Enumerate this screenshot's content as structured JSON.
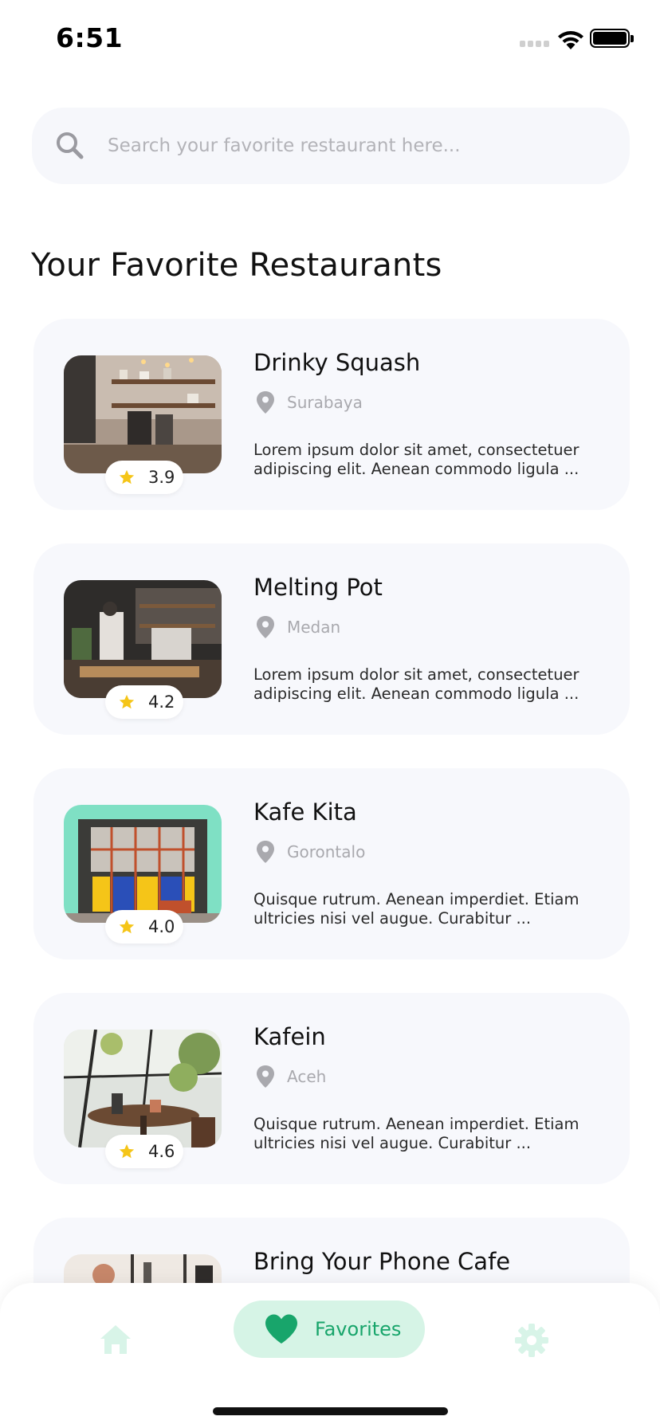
{
  "status_bar": {
    "time": "6:51",
    "icons": [
      "signal-dots-icon",
      "wifi-icon",
      "battery-icon"
    ]
  },
  "search": {
    "icon": "search-icon",
    "placeholder": "Search your favorite restaurant here...",
    "value": ""
  },
  "page": {
    "title": "Your Favorite Restaurants"
  },
  "restaurants": [
    {
      "name": "Drinky Squash",
      "city": "Surabaya",
      "rating": "3.9",
      "description": "Lorem ipsum dolor sit amet, consectetuer adipiscing elit. Aenean commodo ligula ...",
      "image": "cafe-counter-photo"
    },
    {
      "name": "Melting Pot",
      "city": "Medan",
      "rating": "4.2",
      "description": "Lorem ipsum dolor sit amet, consectetuer adipiscing elit. Aenean commodo ligula ...",
      "image": "kitchen-photo"
    },
    {
      "name": "Kafe Kita",
      "city": "Gorontalo",
      "rating": "4.0",
      "description": "Quisque rutrum. Aenean imperdiet. Etiam ultricies nisi vel augue. Curabitur ...",
      "image": "storefront-photo"
    },
    {
      "name": "Kafein",
      "city": "Aceh",
      "rating": "4.6",
      "description": "Quisque rutrum. Aenean imperdiet. Etiam ultricies nisi vel augue. Curabitur ...",
      "image": "garden-table-photo"
    },
    {
      "name": "Bring Your Phone Cafe",
      "city": "",
      "rating": "",
      "description": "",
      "image": "bar-interior-photo"
    }
  ],
  "bottom_nav": {
    "items": [
      {
        "id": "home",
        "label": "",
        "icon": "home-icon",
        "active": false
      },
      {
        "id": "favorites",
        "label": "Favorites",
        "icon": "heart-icon",
        "active": true
      },
      {
        "id": "settings",
        "label": "",
        "icon": "gear-icon",
        "active": false
      }
    ]
  },
  "colors": {
    "accent": "#18a56b",
    "accent_soft": "#d6f4e6",
    "inactive_icon": "#d8f4e8",
    "card_bg": "#f7f8fc",
    "star": "#f5c518",
    "muted_text": "#a9a9ae"
  }
}
